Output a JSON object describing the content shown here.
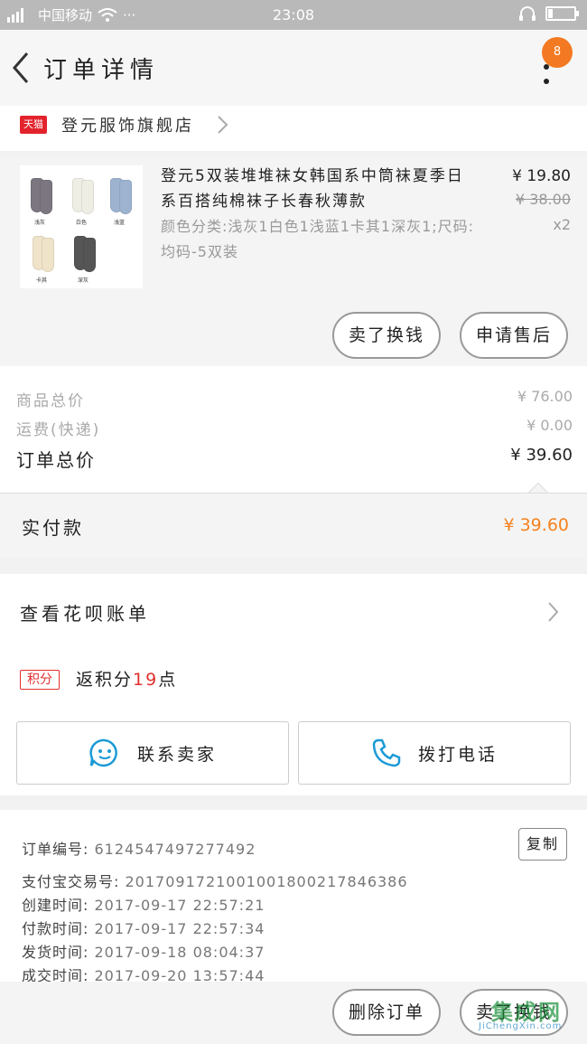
{
  "status_bar": {
    "carrier": "中国移动",
    "time": "23:08"
  },
  "nav": {
    "title": "订单详情",
    "badge_count": "8"
  },
  "store": {
    "logo_text": "天猫",
    "name": "登元服饰旗舰店"
  },
  "product": {
    "title": "登元5双装堆堆袜女韩国系中筒袜夏季日系百搭纯棉袜子长春秋薄款",
    "sku": "颜色分类:浅灰1白色1浅蓝1卡其1深灰1;尺码:均码-5双装",
    "price": "¥ 19.80",
    "original_price": "¥ 38.00",
    "quantity": "x2",
    "image_labels": [
      "浅灰",
      "白色",
      "浅蓝",
      "卡其",
      "深灰"
    ],
    "image_colors": [
      "#7b7680",
      "#efeee4",
      "#9db3cf",
      "#efe3c9",
      "#555556"
    ],
    "btn_buy_again": "卖了换钱",
    "btn_after_sale": "申请售后"
  },
  "summary": {
    "goods_total_label": "商品总价",
    "goods_total": "¥ 76.00",
    "shipping_label": "运费(快递)",
    "shipping": "¥ 0.00",
    "order_total_label": "订单总价",
    "order_total": "¥ 39.60",
    "paid_label": "实付款",
    "paid": "¥ 39.60"
  },
  "huabei": {
    "link_label": "查看花呗账单",
    "points_tag": "积分",
    "points_prefix": "返积分",
    "points_value": "19",
    "points_suffix": "点",
    "contact_seller": "联系卖家",
    "call_phone": "拨打电话"
  },
  "order_info": {
    "order_no_label": "订单编号:",
    "order_no": "6124547497277492",
    "copy": "复制",
    "alipay_label": "支付宝交易号:",
    "alipay_no": "2017091721001001800217846386",
    "created_label": "创建时间:",
    "created": "2017-09-17 22:57:21",
    "paid_label": "付款时间:",
    "paid_time": "2017-09-17 22:57:34",
    "shipped_label": "发货时间:",
    "shipped": "2017-09-18 08:04:37",
    "done_label": "成交时间:",
    "done": "2017-09-20 13:57:44"
  },
  "footer": {
    "delete_order": "删除订单",
    "sell_again": "卖了换钱"
  },
  "watermark": {
    "brand": "集成网",
    "url": "JiChengXin.com"
  },
  "colors": {
    "accent_orange": "#f5821f",
    "points_red": "#e0302f",
    "tmall_red": "#e3232c",
    "contact_blue": "#1b9ad6"
  }
}
